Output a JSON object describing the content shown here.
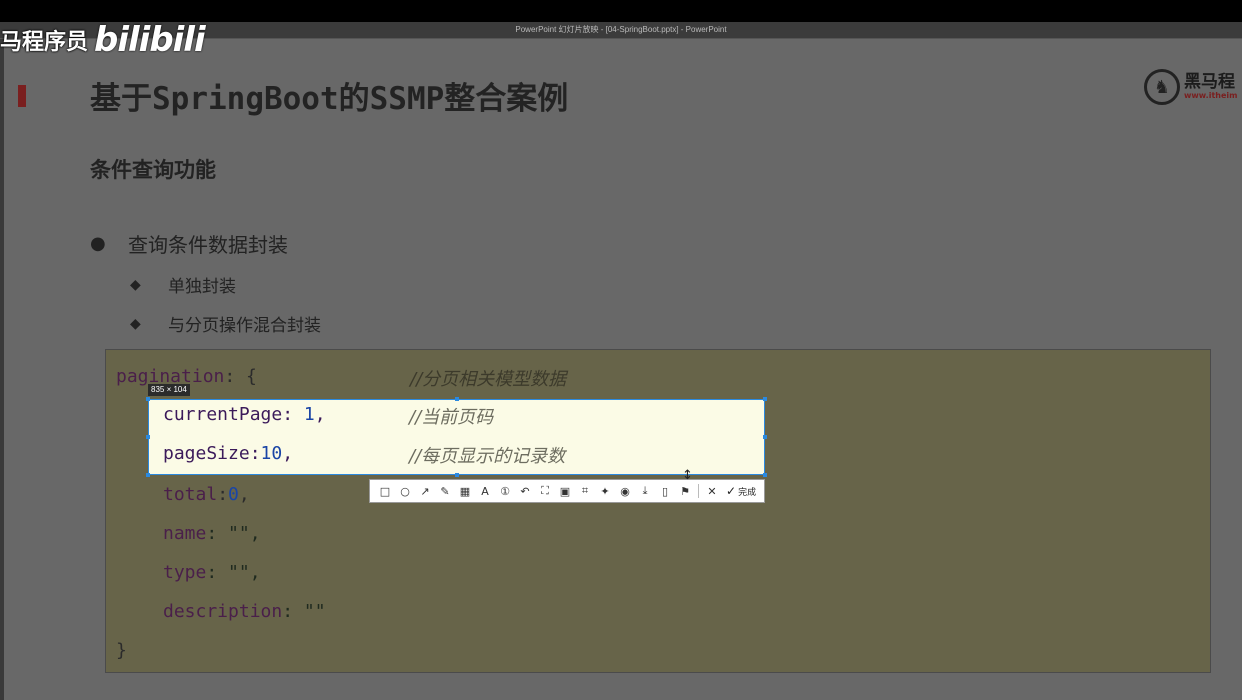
{
  "window": {
    "title": "PowerPoint 幻灯片放映 - [04-SpringBoot.pptx] - PowerPoint"
  },
  "watermark": {
    "text": "马程序员",
    "logo": "bilibili"
  },
  "slide": {
    "title": "基于SpringBoot的SSMP整合案例",
    "brand_name": "黑马程",
    "brand_url": "www.itheim",
    "subtitle": "条件查询功能",
    "bullets": [
      {
        "level": 1,
        "text": "查询条件数据封装"
      },
      {
        "level": 2,
        "text": "单独封装"
      },
      {
        "level": 2,
        "text": "与分页操作混合封装"
      }
    ],
    "code": {
      "line1_key": "pagination",
      "line1_rest": ": {",
      "line1_comment": "//分页相关模型数据",
      "line2_key": "currentPage",
      "line2_sep": ": ",
      "line2_val": "1",
      "line2_end": ",",
      "line2_comment": "//当前页码",
      "line3_key": "pageSize",
      "line3_sep": ":",
      "line3_val": "10",
      "line3_end": ",",
      "line3_comment": "//每页显示的记录数",
      "line4_key": "total",
      "line4_sep": ":",
      "line4_val": "0",
      "line4_end": ",",
      "line5_key": "name",
      "line5_rest": ": \"\",",
      "line6_key": "type",
      "line6_rest": ": \"\",",
      "line7_key": "description",
      "line7_rest": ": \"\"",
      "line8": "}"
    }
  },
  "screenshot_tool": {
    "size_label": "835 × 104",
    "done_label": "完成",
    "tools": [
      {
        "name": "rectangle-icon",
        "glyph": "□"
      },
      {
        "name": "ellipse-icon",
        "glyph": "○"
      },
      {
        "name": "arrow-icon",
        "glyph": "↗"
      },
      {
        "name": "pen-icon",
        "glyph": "✎"
      },
      {
        "name": "mosaic-icon",
        "glyph": "▦"
      },
      {
        "name": "text-icon",
        "glyph": "A"
      },
      {
        "name": "number-icon",
        "glyph": "①"
      },
      {
        "name": "undo-icon",
        "glyph": "↶"
      },
      {
        "name": "ocr-icon",
        "glyph": "⛶"
      },
      {
        "name": "translate-icon",
        "glyph": "▣"
      },
      {
        "name": "scan-icon",
        "glyph": "⌗"
      },
      {
        "name": "pin-icon",
        "glyph": "✦"
      },
      {
        "name": "record-icon",
        "glyph": "◉"
      },
      {
        "name": "download-icon",
        "glyph": "⤓"
      },
      {
        "name": "save-icon",
        "glyph": "▯"
      },
      {
        "name": "bookmark-icon",
        "glyph": "⚑"
      }
    ]
  },
  "colors": {
    "slide_bg": "#686868",
    "code_bg": "#676449",
    "selection_border": "#2b8ae0",
    "accent": "#7a1f1f"
  }
}
